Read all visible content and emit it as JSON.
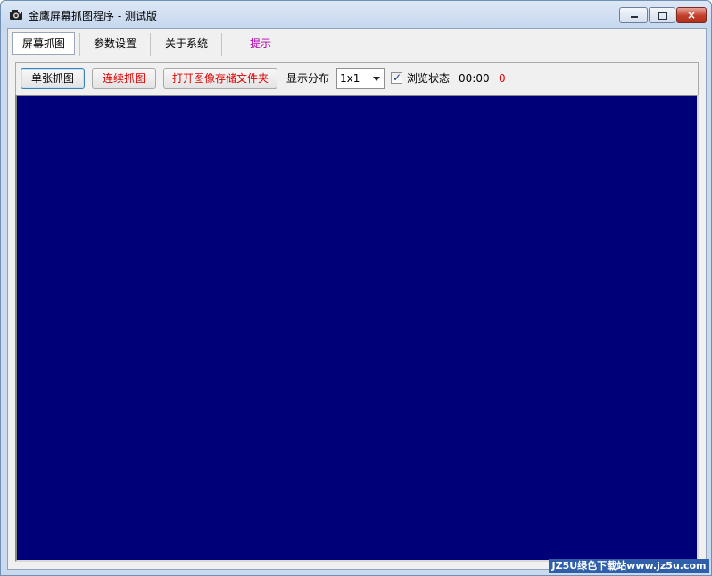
{
  "window": {
    "title": "金鹰屏幕抓图程序 - 测试版",
    "buttons": {
      "minimize": "minimize",
      "maximize": "maximize",
      "close": "×"
    }
  },
  "tabs": [
    {
      "label": "屏幕抓图",
      "active": true
    },
    {
      "label": "参数设置",
      "active": false
    },
    {
      "label": "关于系统",
      "active": false
    },
    {
      "label": "提示",
      "active": false,
      "color": "#b000b0"
    }
  ],
  "toolbar": {
    "single_capture": "单张抓图",
    "continuous_capture": "连续抓图",
    "open_folder": "打开图像存储文件夹",
    "layout_label": "显示分布",
    "layout_value": "1x1",
    "browse_label": "浏览状态",
    "browse_checked": true,
    "time": "00:00",
    "count": "0"
  },
  "colors": {
    "viewport": "#000078",
    "accent_red": "#e00000",
    "tip": "#b000b0"
  },
  "watermark": "JZ5U绿色下载站www.jz5u.com"
}
